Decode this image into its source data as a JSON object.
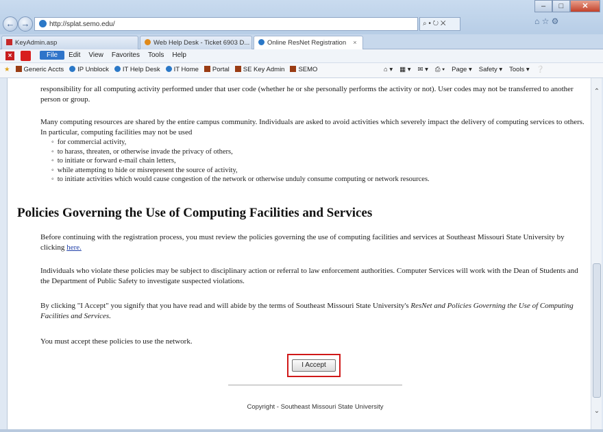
{
  "browser": {
    "address": "http://splat.semo.edu/",
    "address_tools": "⌕ • ↻ ✕",
    "tabs": [
      {
        "label": "KeyAdmin.asp"
      },
      {
        "label": "Web Help Desk - Ticket 6903 D..."
      },
      {
        "label": "Online ResNet Registration",
        "close": "×"
      }
    ],
    "menu": [
      "File",
      "Edit",
      "View",
      "Favorites",
      "Tools",
      "Help"
    ],
    "favorites": [
      "Generic Accts",
      "IP Unblock",
      "IT Help Desk",
      "IT Home",
      "Portal",
      "SE Key Admin",
      "SEMO"
    ],
    "tools": [
      "Page ▾",
      "Safety ▾",
      "Tools ▾"
    ],
    "window_buttons": {
      "minimize": "–",
      "maximize": "□",
      "close": "✕"
    }
  },
  "page": {
    "para1": "responsibility for all computing activity performed under that user code (whether he or she personally performs the activity or not). User codes may not be transferred to another person or group.",
    "para2": "Many computing resources are shared by the entire campus community. Individuals are asked to avoid activities which severely impact the delivery of computing services to others. In particular, computing facilities may not be used",
    "list": [
      "for commercial activity,",
      "to harass, threaten, or otherwise invade the privacy of others,",
      "to initiate or forward e-mail chain letters,",
      "while attempting to hide or misrepresent the source of activity,",
      "to initiate activities which would cause congestion of the network or otherwise unduly consume computing or network resources."
    ],
    "heading": "Policies Governing the Use of Computing Facilities and Services",
    "para3_text": "Before continuing with the registration process, you must review the policies governing the use of computing facilities and services at Southeast Missouri State University by clicking ",
    "para3_link": "here.",
    "para4": "Individuals who violate these policies may be subject to disciplinary action or referral to law enforcement authorities. Computer Services will work with the Dean of Students and the Department of Public Safety to investigate suspected violations.",
    "para5_text": "By clicking \"I Accept\" you signify that you have read and will abide by the terms of Southeast Missouri State University's ",
    "para5_italic": "ResNet and Policies Governing the Use of Computing Facilities and Services.",
    "para6": "You must accept these policies to use the network.",
    "accept_button": "I Accept",
    "copyright": "Copyright - Southeast Missouri State University"
  }
}
